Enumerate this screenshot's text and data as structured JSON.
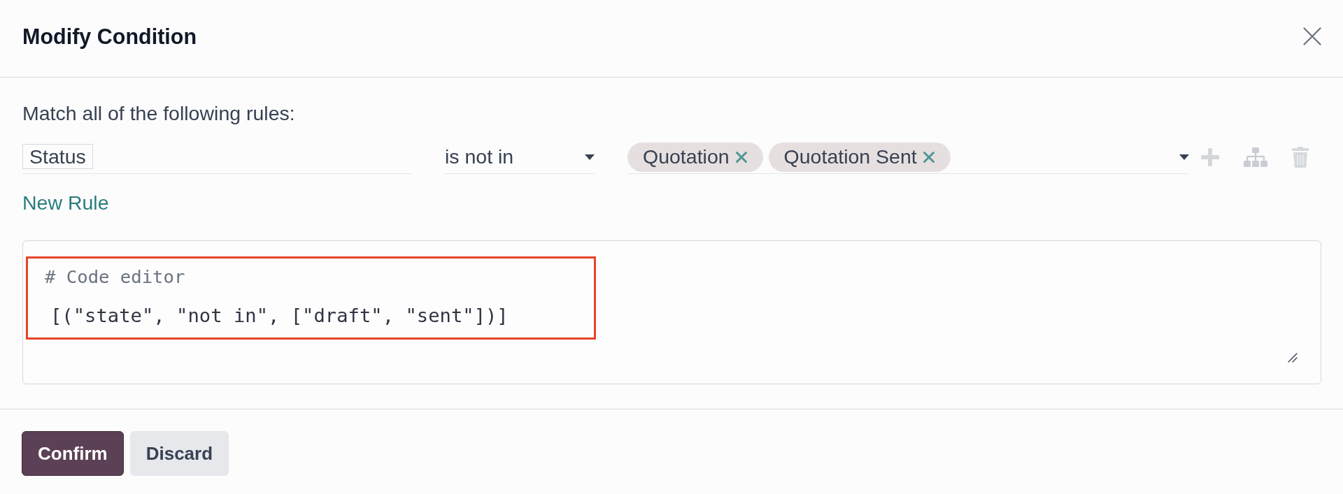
{
  "dialog": {
    "title": "Modify Condition"
  },
  "rules_intro": "Match all of the following rules:",
  "rules": [
    {
      "field": "Status",
      "operator": "is not in",
      "values": [
        "Quotation",
        "Quotation Sent"
      ]
    }
  ],
  "new_rule_link": "New Rule",
  "code_editor": {
    "comment": "# Code editor",
    "code": "[(\"state\", \"not in\", [\"draft\", \"sent\"])]",
    "highlighted": true
  },
  "buttons": [
    {
      "label": "Confirm",
      "kind": "primary"
    },
    {
      "label": "Discard",
      "kind": "secondary"
    }
  ]
}
